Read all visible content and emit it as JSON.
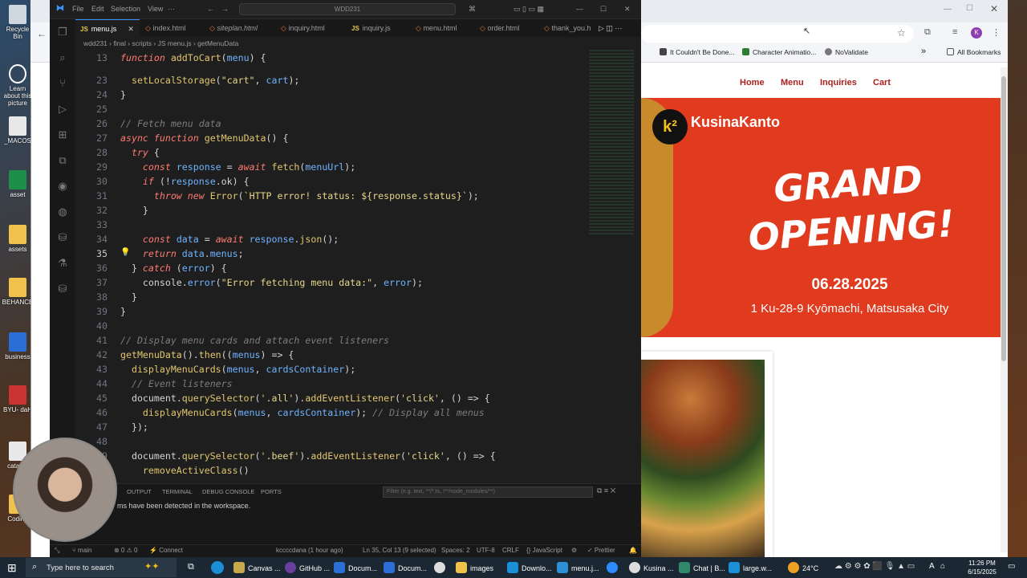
{
  "desktop": {
    "icons": [
      {
        "label": "Recycle Bin"
      },
      {
        "label": "Learn about this picture"
      },
      {
        "label": "_MACOS"
      },
      {
        "label": "asset"
      },
      {
        "label": "assets"
      },
      {
        "label": "BEHANCE"
      },
      {
        "label": "business"
      },
      {
        "label": "BYU- daH"
      },
      {
        "label": "catalog"
      },
      {
        "label": "Coding"
      }
    ]
  },
  "browser": {
    "bookmarks": [
      "It Couldn't Be Done...",
      "Character Animatio...",
      "NoValidate"
    ],
    "all_bookmarks": "All Bookmarks",
    "profile_initial": "K",
    "site": {
      "nav": [
        "Home",
        "Menu",
        "Inquiries",
        "Cart"
      ],
      "brand": "KusinaKanto",
      "logo_mark": "k²",
      "hero_title_line1": "GRAND",
      "hero_title_line2": "OPENING!",
      "hero_date": "06.28.2025",
      "hero_address": "1 Ku-28-9 Kyōmachi, Matsusaka City"
    }
  },
  "vscode": {
    "menu": [
      "File",
      "Edit",
      "Selection",
      "View"
    ],
    "search_placeholder": "WDD231",
    "tabs": [
      "menu.js",
      "index.html",
      "siteplan.html",
      "inquiry.html",
      "inquiry.js",
      "menu.html",
      "order.html",
      "thank_you.h"
    ],
    "breadcrumb": "wdd231 › final › scripts › JS menu.js › getMenuData",
    "panel_tabs": [
      "OUTPUT",
      "TERMINAL",
      "DEBUG CONSOLE",
      "PORTS"
    ],
    "panel_filter_placeholder": "Filter (e.g. text, **/*.ts, !**/node_modules/**)",
    "panel_message": "ms have been detected in the workspace.",
    "status": {
      "branch": "main",
      "errors": "⊗ 0 ⚠ 0",
      "connect": "Connect",
      "blame": "kccccdana (1 hour ago)",
      "position": "Ln 35, Col 13 (9 selected)",
      "spaces": "Spaces: 2",
      "encoding": "UTF-8",
      "eol": "CRLF",
      "language": "{} JavaScript",
      "prettier": "✓ Prettier"
    },
    "code": [
      {
        "n": "13",
        "t": "function addToCart(menu) {"
      },
      {
        "n": "23",
        "t": "  setLocalStorage(\"cart\", cart);"
      },
      {
        "n": "24",
        "t": "}"
      },
      {
        "n": "25",
        "t": ""
      },
      {
        "n": "26",
        "t": "// Fetch menu data"
      },
      {
        "n": "27",
        "t": "async function getMenuData() {"
      },
      {
        "n": "28",
        "t": "  try {"
      },
      {
        "n": "29",
        "t": "    const response = await fetch(menuUrl);"
      },
      {
        "n": "30",
        "t": "    if (!response.ok) {"
      },
      {
        "n": "31",
        "t": "      throw new Error(`HTTP error! status: ${response.status}`);"
      },
      {
        "n": "32",
        "t": "    }"
      },
      {
        "n": "33",
        "t": ""
      },
      {
        "n": "34",
        "t": "    const data = await response.json();"
      },
      {
        "n": "35",
        "t": "    return data.menus;"
      },
      {
        "n": "36",
        "t": "  } catch (error) {"
      },
      {
        "n": "37",
        "t": "    console.error(\"Error fetching menu data:\", error);"
      },
      {
        "n": "38",
        "t": "  }"
      },
      {
        "n": "39",
        "t": "}"
      },
      {
        "n": "40",
        "t": ""
      },
      {
        "n": "41",
        "t": "// Display menu cards and attach event listeners"
      },
      {
        "n": "42",
        "t": "getMenuData().then((menus) => {"
      },
      {
        "n": "43",
        "t": "  displayMenuCards(menus, cardsContainer);"
      },
      {
        "n": "44",
        "t": "  // Event listeners"
      },
      {
        "n": "45",
        "t": "  document.querySelector('.all').addEventListener('click', () => {"
      },
      {
        "n": "46",
        "t": "    displayMenuCards(menus, cardsContainer); // Display all menus"
      },
      {
        "n": "47",
        "t": "  });"
      },
      {
        "n": "48",
        "t": ""
      },
      {
        "n": "49",
        "t": "  document.querySelector('.beef').addEventListener('click', () => {"
      },
      {
        "n": "50",
        "t": "    removeActiveClass()"
      }
    ]
  },
  "taskbar": {
    "search_placeholder": "Type here to search",
    "apps": [
      "Canvas ...",
      "GitHub ...",
      "Docum...",
      "Docum...",
      "images",
      "Downlo...",
      "menu.j...",
      "Kusina ...",
      "Chat | B...",
      "large.w..."
    ],
    "weather": "24°C",
    "time": "11:26 PM",
    "date": "6/15/2025"
  }
}
